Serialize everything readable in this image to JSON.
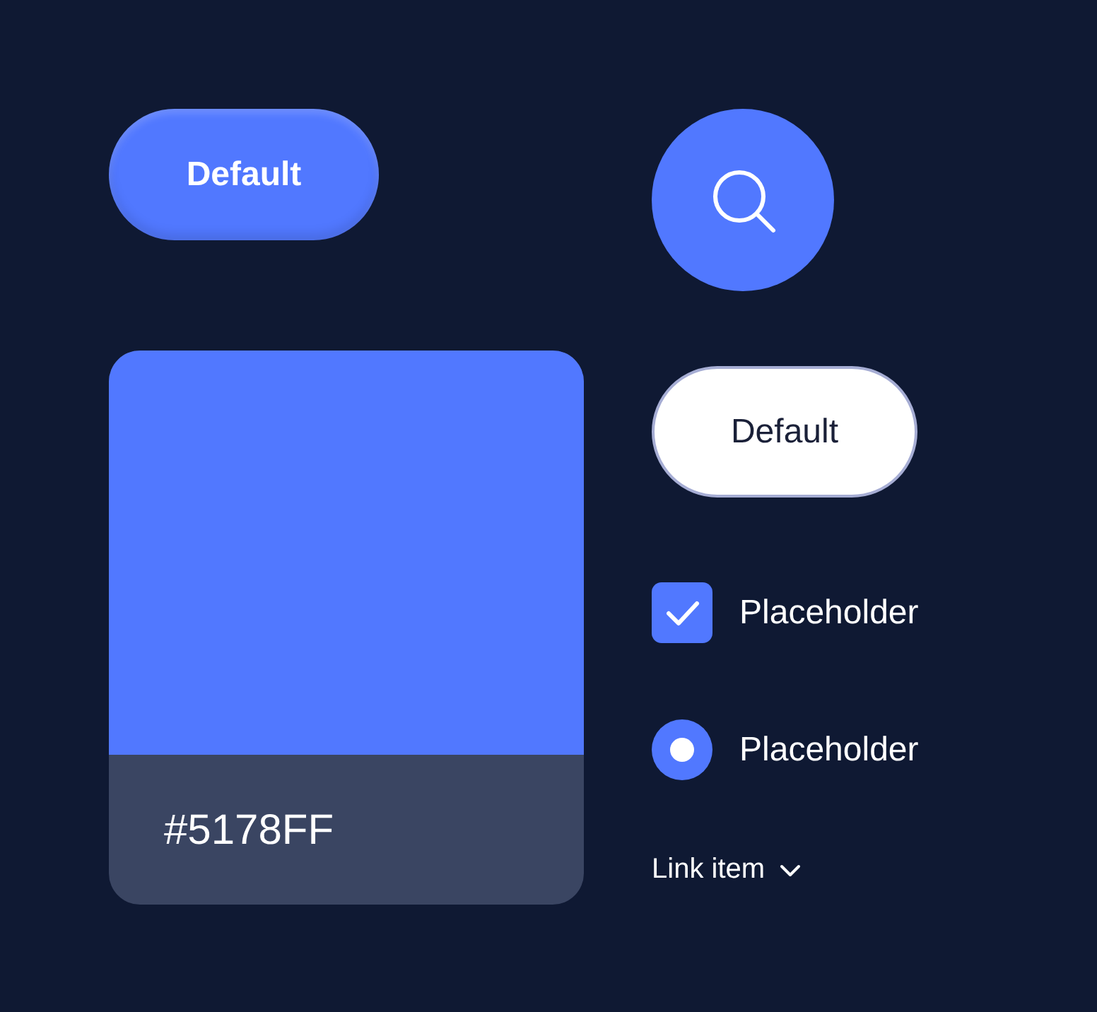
{
  "primary_button": {
    "label": "Default"
  },
  "color_swatch": {
    "label": "#5178FF"
  },
  "secondary_button": {
    "label": "Default"
  },
  "checkbox": {
    "label": "Placeholder",
    "checked": true
  },
  "radio": {
    "label": "Placeholder",
    "selected": true
  },
  "link": {
    "label": "Link item"
  }
}
